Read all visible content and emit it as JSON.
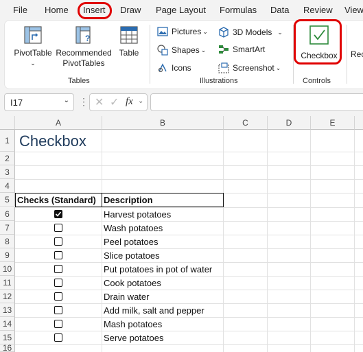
{
  "menu": {
    "tabs": [
      "File",
      "Home",
      "Insert",
      "Draw",
      "Page Layout",
      "Formulas",
      "Data",
      "Review",
      "View"
    ]
  },
  "ribbon": {
    "tables": {
      "pivot_table": "PivotTable",
      "recommended_line1": "Recommended",
      "recommended_line2": "PivotTables",
      "table": "Table",
      "group_label": "Tables"
    },
    "illustrations": {
      "pictures": "Pictures",
      "shapes": "Shapes",
      "icons": "Icons",
      "models_3d": "3D Models",
      "smartart": "SmartArt",
      "screenshot": "Screenshot",
      "group_label": "Illustrations"
    },
    "controls": {
      "checkbox": "Checkbox",
      "group_label": "Controls"
    },
    "cut_off": "Rec"
  },
  "formula_bar": {
    "name_box": "I17",
    "fx_label": "fx",
    "formula": ""
  },
  "columns": [
    "A",
    "B",
    "C",
    "D",
    "E"
  ],
  "rows": [
    "1",
    "2",
    "3",
    "4",
    "5",
    "6",
    "7",
    "8",
    "9",
    "10",
    "11",
    "12",
    "13",
    "14",
    "15",
    "16"
  ],
  "sheet": {
    "title": "Checkbox",
    "header_checks": "Checks (Standard)",
    "header_description": "Description",
    "tasks": [
      {
        "description": "Harvest potatoes",
        "checked": true
      },
      {
        "description": "Wash potatoes",
        "checked": false
      },
      {
        "description": "Peel potatoes",
        "checked": false
      },
      {
        "description": "Slice potatoes",
        "checked": false
      },
      {
        "description": "Put potatoes in pot of water",
        "checked": false
      },
      {
        "description": "Cook potatoes",
        "checked": false
      },
      {
        "description": "Drain water",
        "checked": false
      },
      {
        "description": "Add milk, salt and pepper",
        "checked": false
      },
      {
        "description": "Mash potatoes",
        "checked": false
      },
      {
        "description": "Serve potatoes",
        "checked": false
      }
    ]
  },
  "colors": {
    "highlight": "#e00000",
    "checkbox_green": "#2e8b3c",
    "icon_blue": "#2b6cb0"
  }
}
